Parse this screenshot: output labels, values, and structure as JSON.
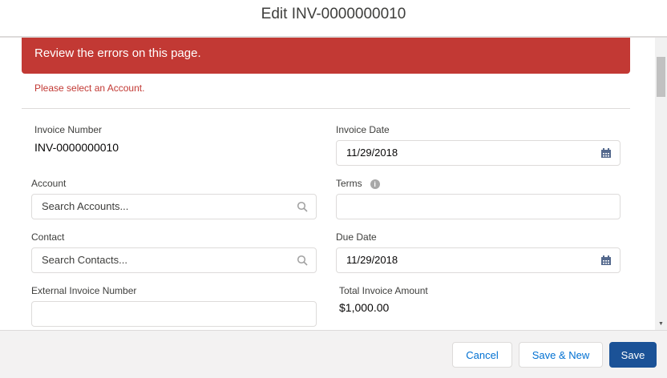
{
  "header": {
    "title": "Edit INV-0000000010"
  },
  "errors": {
    "banner": "Review the errors on this page.",
    "messages": [
      "Please select an Account."
    ]
  },
  "fields": {
    "invoice_number": {
      "label": "Invoice Number",
      "value": "INV-0000000010"
    },
    "invoice_date": {
      "label": "Invoice Date",
      "value": "11/29/2018"
    },
    "account": {
      "label": "Account",
      "placeholder": "Search Accounts..."
    },
    "terms": {
      "label": "Terms",
      "value": ""
    },
    "contact": {
      "label": "Contact",
      "placeholder": "Search Contacts..."
    },
    "due_date": {
      "label": "Due Date",
      "value": "11/29/2018"
    },
    "external_invoice_number": {
      "label": "External Invoice Number",
      "value": ""
    },
    "total_invoice_amount": {
      "label": "Total Invoice Amount",
      "value": "$1,000.00"
    }
  },
  "footer": {
    "cancel": "Cancel",
    "save_new": "Save & New",
    "save": "Save"
  }
}
